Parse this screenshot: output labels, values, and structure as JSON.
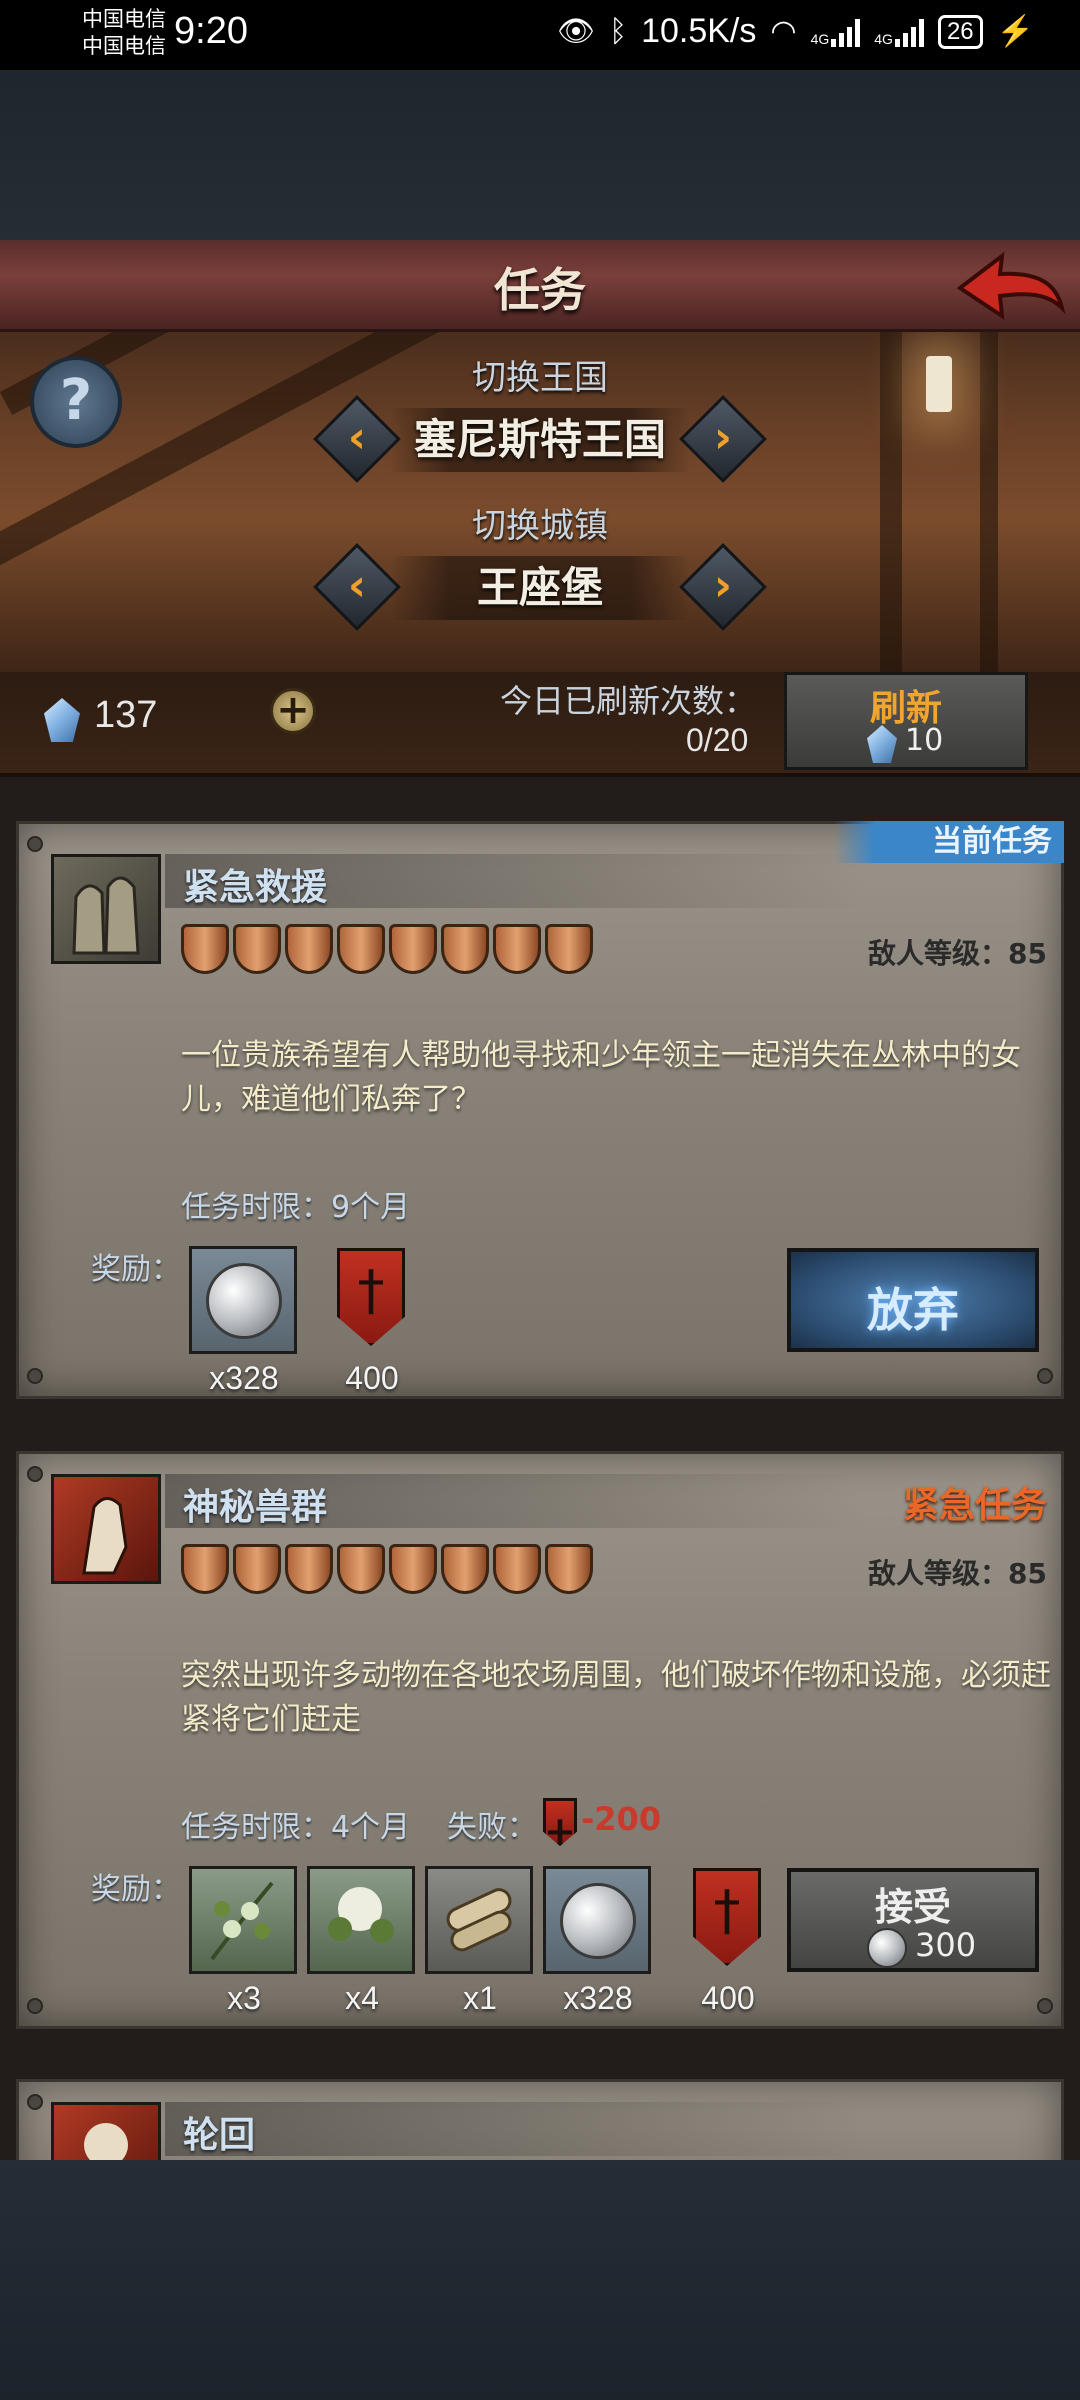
{
  "status_bar": {
    "carrier1": "中国电信",
    "carrier2": "中国电信",
    "time": "9:20",
    "net_speed": "10.5K/s",
    "net_type1": "4G",
    "net_type2": "4G",
    "battery": "26"
  },
  "header": {
    "title": "任务"
  },
  "region": {
    "kingdom_label": "切换王国",
    "kingdom_value": "塞尼斯特王国",
    "town_label": "切换城镇",
    "town_value": "王座堡"
  },
  "resources": {
    "gems": "137",
    "refresh_label": "今日已刷新次数：",
    "refresh_count": "0/20",
    "refresh_button": "刷新",
    "refresh_cost": "10"
  },
  "tasks": [
    {
      "tag": "当前任务",
      "name": "紧急救援",
      "difficulty": 8,
      "enemy_level": "敌人等级：85",
      "description": "一位贵族希望有人帮助他寻找和少年领主一起消失在丛林中的女儿，难道他们私奔了？",
      "duration": "任务时限：9个月",
      "reward_label": "奖励：",
      "rewards": [
        {
          "icon": "silver-coin-icon",
          "qty": "x328"
        },
        {
          "icon": "red-banner-icon",
          "qty": "400"
        }
      ],
      "action": "放弃"
    },
    {
      "tag": "紧急任务",
      "name": "神秘兽群",
      "difficulty": 8,
      "enemy_level": "敌人等级：85",
      "description": "突然出现许多动物在各地农场周围，他们破坏作物和设施，必须赶紧将它们赶走",
      "duration": "任务时限：4个月",
      "fail_label": "失败：",
      "fail_value": "-200",
      "reward_label": "奖励：",
      "rewards": [
        {
          "icon": "mistletoe-herb-icon",
          "qty": "x3"
        },
        {
          "icon": "white-flower-icon",
          "qty": "x4"
        },
        {
          "icon": "scroll-icon",
          "qty": "x1"
        },
        {
          "icon": "silver-coin-icon",
          "qty": "x328"
        },
        {
          "icon": "red-banner-icon",
          "qty": "400"
        }
      ],
      "action": "接受",
      "action_cost": "300"
    },
    {
      "name": "轮回"
    }
  ],
  "colors": {
    "accent_orange": "#f0a02a",
    "current_tag_blue": "#3a86c8",
    "urgent_orange": "#e8682a",
    "fail_red": "#c93a2c"
  }
}
